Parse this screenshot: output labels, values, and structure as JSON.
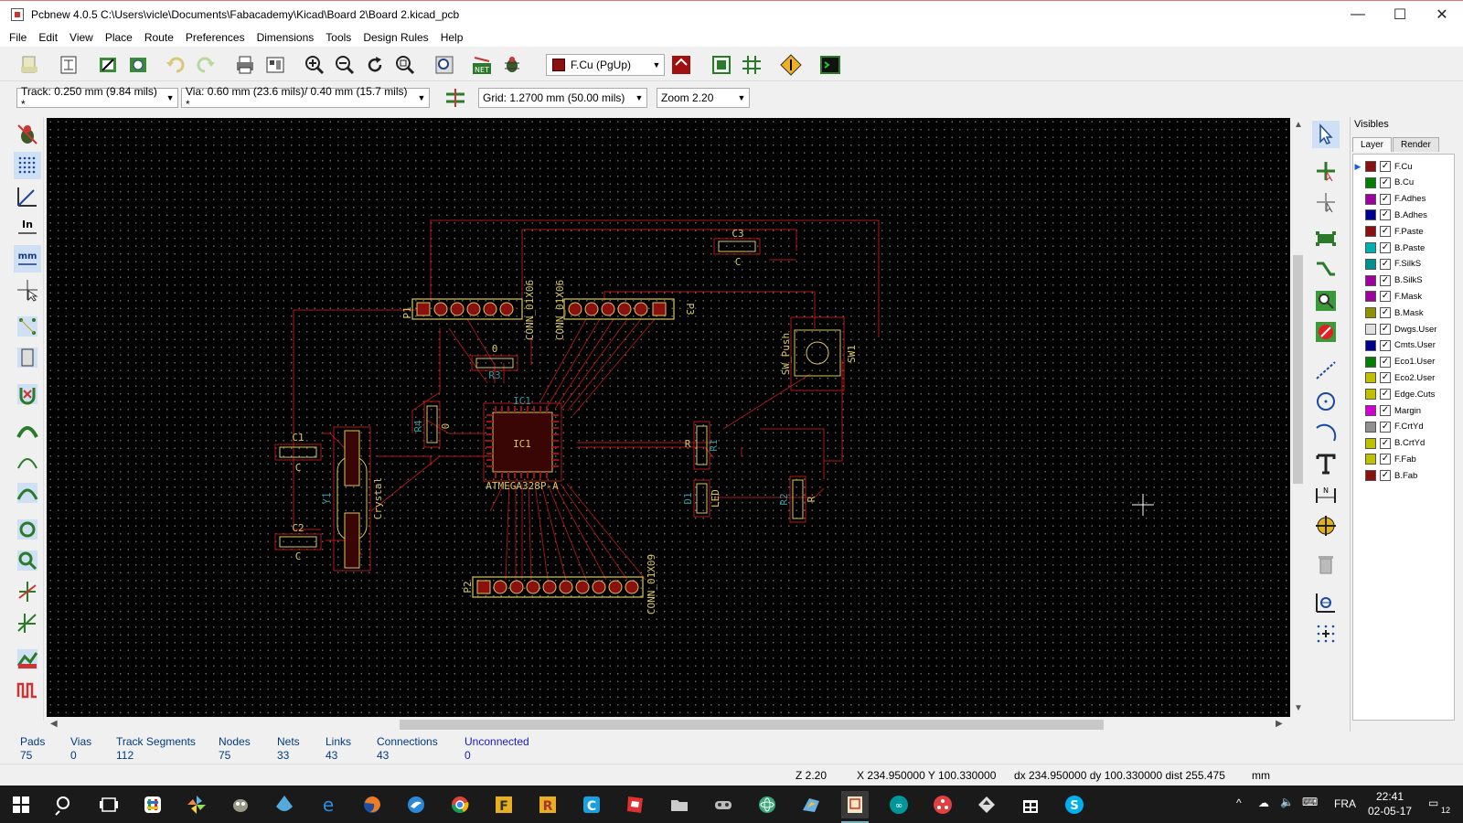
{
  "window": {
    "title": "Pcbnew 4.0.5 C:\\Users\\vicle\\Documents\\Fabacademy\\Kicad\\Board 2\\Board 2.kicad_pcb",
    "minimize": "—",
    "maximize": "☐",
    "close": "✕"
  },
  "menu": [
    "File",
    "Edit",
    "View",
    "Place",
    "Route",
    "Preferences",
    "Dimensions",
    "Tools",
    "Design Rules",
    "Help"
  ],
  "toolbar": {
    "layer_select": "F.Cu (PgUp)",
    "track_width": "Track: 0.250 mm (9.84 mils) *",
    "via_size": "Via: 0.60 mm (23.6 mils)/ 0.40 mm (15.7 mils) *",
    "grid": "Grid: 1.2700 mm (50.00 mils)",
    "zoom": "Zoom 2.20",
    "net_label": "NET"
  },
  "left_tools": {
    "inch_label": "In",
    "mm_label": "mm"
  },
  "pcb": {
    "labels": {
      "C3": "C3",
      "C3v": "C",
      "P1": "P1",
      "P1conn": "CONN_01X06",
      "P3conn": "CONN_01X06",
      "P3": "P3",
      "R3v": "0",
      "R3": "R3",
      "SW1": "SW1",
      "SWv": "SW_Push",
      "R4": "R4",
      "R4v": "0",
      "IC1top": "IC1",
      "IC1": "IC1",
      "ICv": "ATMEGA328P-A",
      "C1": "C1",
      "C1v": "C",
      "C2": "C2",
      "C2v": "C",
      "Y1": "Y1",
      "Y1v": "Crystal",
      "R1": "R",
      "R1b": "R1",
      "D1": "D1",
      "LED": "LED",
      "R2": "R2",
      "R2v": "R",
      "P2": "P2",
      "P2conn": "CONN_01X09"
    }
  },
  "visibles": {
    "title": "Visibles",
    "tabs": [
      "Layer",
      "Render"
    ],
    "layers": [
      {
        "name": "F.Cu",
        "color": "#8b1010"
      },
      {
        "name": "B.Cu",
        "color": "#008000"
      },
      {
        "name": "F.Adhes",
        "color": "#a000a0"
      },
      {
        "name": "B.Adhes",
        "color": "#000090"
      },
      {
        "name": "F.Paste",
        "color": "#8b1010"
      },
      {
        "name": "B.Paste",
        "color": "#00b0b0"
      },
      {
        "name": "F.SilkS",
        "color": "#009090"
      },
      {
        "name": "B.SilkS",
        "color": "#a000a0"
      },
      {
        "name": "F.Mask",
        "color": "#a000a0"
      },
      {
        "name": "B.Mask",
        "color": "#909000"
      },
      {
        "name": "Dwgs.User",
        "color": "#e0e0e0"
      },
      {
        "name": "Cmts.User",
        "color": "#000090"
      },
      {
        "name": "Eco1.User",
        "color": "#008000"
      },
      {
        "name": "Eco2.User",
        "color": "#c0c000"
      },
      {
        "name": "Edge.Cuts",
        "color": "#c0c000"
      },
      {
        "name": "Margin",
        "color": "#d000d0"
      },
      {
        "name": "F.CrtYd",
        "color": "#909090"
      },
      {
        "name": "B.CrtYd",
        "color": "#c0c000"
      },
      {
        "name": "F.Fab",
        "color": "#c0c000"
      },
      {
        "name": "B.Fab",
        "color": "#8b1010"
      }
    ],
    "check": "✓"
  },
  "stats": [
    {
      "label": "Pads",
      "value": "75"
    },
    {
      "label": "Vias",
      "value": "0"
    },
    {
      "label": "Track Segments",
      "value": "112"
    },
    {
      "label": "Nodes",
      "value": "75"
    },
    {
      "label": "Nets",
      "value": "33"
    },
    {
      "label": "Links",
      "value": "43"
    },
    {
      "label": "Connections",
      "value": "43"
    },
    {
      "label": "Unconnected",
      "value": "0"
    }
  ],
  "statusbar": {
    "zoom": "Z 2.20",
    "xy": "X 234.950000  Y 100.330000",
    "delta": "dx 234.950000  dy 100.330000  dist 255.475",
    "units": "mm"
  },
  "taskbar": {
    "lang": "FRA",
    "time": "22:41",
    "date": "02-05-17",
    "notif": "12"
  }
}
